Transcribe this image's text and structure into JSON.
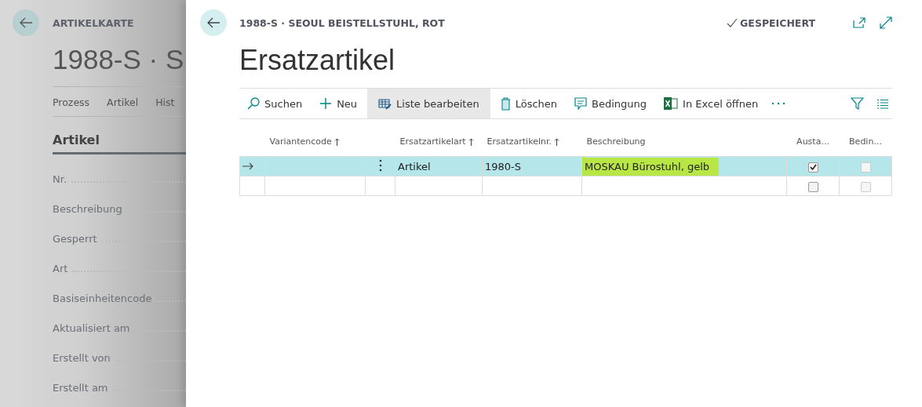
{
  "background_page": {
    "caption": "ARTIKELKARTE",
    "title": "1988-S · S",
    "tabs": [
      "Prozess",
      "Artikel",
      "Hist"
    ],
    "section": "Artikel",
    "fields": [
      "Nr.",
      "Beschreibung",
      "Gesperrt",
      "Art",
      "Basiseinheitencode",
      "Aktualisiert am",
      "Erstellt von",
      "Erstellt am"
    ]
  },
  "dialog": {
    "caption": "1988-S · SEOUL BEISTELLSTUHL, ROT",
    "status": "GESPEICHERT",
    "title": "Ersatzartikel",
    "actions": [
      {
        "kind": "search",
        "label": "Suchen",
        "selected": false
      },
      {
        "kind": "new",
        "label": "Neu",
        "selected": false
      },
      {
        "kind": "edit",
        "label": "Liste bearbeiten",
        "selected": true
      },
      {
        "kind": "delete",
        "label": "Löschen",
        "selected": false
      },
      {
        "kind": "comment",
        "label": "Bedingung",
        "selected": false
      },
      {
        "kind": "excel",
        "label": "In Excel öffnen",
        "selected": false
      }
    ],
    "table": {
      "columns": [
        {
          "label": "Variantencode",
          "sorted": true
        },
        {
          "label": "Ersatzartikelart",
          "sorted": true
        },
        {
          "label": "Ersatzartikelnr.",
          "sorted": true
        },
        {
          "label": "Beschreibung",
          "sorted": false
        },
        {
          "label": "Austa...",
          "sorted": false
        },
        {
          "label": "Bedin...",
          "sorted": false
        }
      ],
      "rows": [
        {
          "selected": true,
          "art": "Artikel",
          "nr": "1980-S",
          "beschreibung": "MOSKAU Bürostuhl, gelb",
          "highlighted": true,
          "austausch": true,
          "bedingung": false
        },
        {
          "selected": false,
          "highlighted": false,
          "austausch": false,
          "bedingung": false
        }
      ]
    }
  }
}
